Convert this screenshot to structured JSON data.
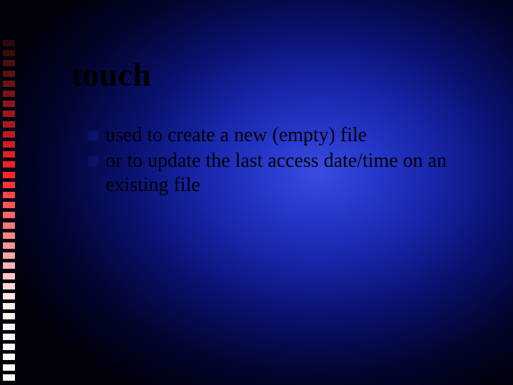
{
  "slide": {
    "title": "touch",
    "bullets": [
      {
        "text": "used to create a new (empty) file"
      },
      {
        "text": "or to update the last access date/time on an existing file"
      }
    ],
    "deco_squares": [
      "#2a0a0a",
      "#3a0d0d",
      "#4a0f0f",
      "#5b1111",
      "#6b1313",
      "#7c1515",
      "#8c1717",
      "#9d1919",
      "#ad1b1b",
      "#be1d1d",
      "#ce1f1f",
      "#df2121",
      "#ef2323",
      "#ff2525",
      "#ff3535",
      "#ff4545",
      "#ff5555",
      "#ff6565",
      "#ff7575",
      "#ff8585",
      "#ff9595",
      "#ffa5a5",
      "#ffb5b5",
      "#ffc5c5",
      "#ffd5d5",
      "#ffe5e5",
      "#ffecec",
      "#fff0f0",
      "#fff4f4",
      "#fff6f6",
      "#fff8f8",
      "#fffafa",
      "#fffcfc",
      "#fffefe"
    ]
  }
}
